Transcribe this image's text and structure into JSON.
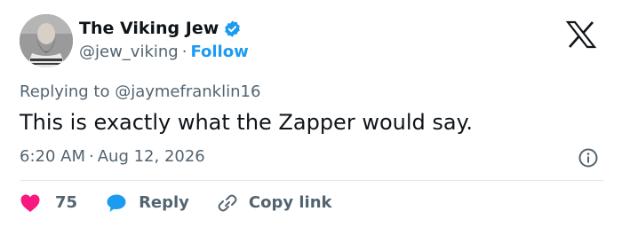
{
  "tweet": {
    "author": {
      "display_name": "The Viking Jew",
      "handle": "@jew_viking",
      "verified": true,
      "follow_label": "Follow"
    },
    "replying_to": {
      "prefix": "Replying to",
      "mention": "@jaymefranklin16"
    },
    "text": "This is exactly what the Zapper would say.",
    "time": "6:20 AM",
    "date": "Aug 12, 2026",
    "separator": "·"
  },
  "actions": {
    "like_count": "75",
    "reply_label": "Reply",
    "copy_link_label": "Copy link"
  },
  "icons": {
    "verified": "verified-badge-icon",
    "platform_logo": "x-logo-icon",
    "info": "info-icon",
    "like": "heart-icon",
    "reply": "speech-bubble-icon",
    "copy": "link-icon"
  },
  "colors": {
    "accent": "#1d9bf0",
    "like": "#f91880",
    "text_primary": "#0f1419",
    "text_secondary": "#536471"
  }
}
